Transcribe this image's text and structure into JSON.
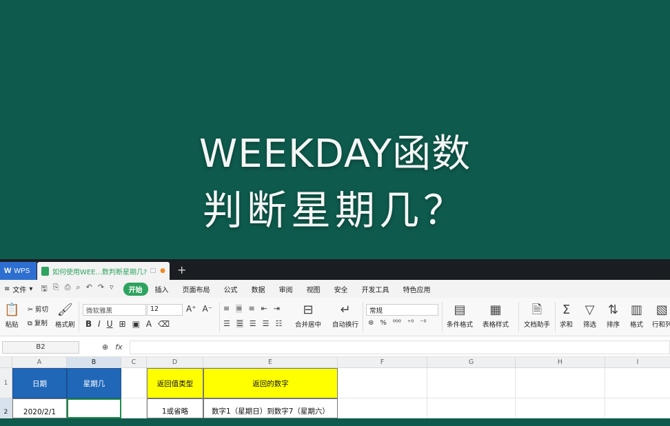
{
  "banner": {
    "line1": "WEEKDAY函数",
    "line2": "判断星期几？"
  },
  "tabbar": {
    "app_tab": "WPS",
    "doc_tab": "如何使用WEE...数判断星期几?",
    "new_tab": "+"
  },
  "menubar": {
    "file": "文件",
    "items": [
      "开始",
      "插入",
      "页面布局",
      "公式",
      "数据",
      "审阅",
      "视图",
      "安全",
      "开发工具",
      "特色应用"
    ]
  },
  "ribbon": {
    "paste": "粘贴",
    "cut": "剪切",
    "copy": "复制",
    "format_painter": "格式刷",
    "font_name": "微软雅黑",
    "font_size": "12",
    "merge_center": "合并居中",
    "wrap_text": "自动换行",
    "number_format": "常规",
    "conditional_format": "条件格式",
    "table_style": "表格样式",
    "doc_assistant": "文档助手",
    "sum": "求和",
    "filter": "筛选",
    "sort": "排序",
    "format": "格式",
    "row_col": "行和列"
  },
  "formula": {
    "name_box": "B2",
    "fx": "fx",
    "value": ""
  },
  "columns": [
    "A",
    "B",
    "C",
    "D",
    "E",
    "F",
    "G",
    "H",
    "I"
  ],
  "rows": [
    "1",
    "2"
  ],
  "cells": {
    "A1": "日期",
    "B1": "星期几",
    "D1": "返回值类型",
    "E1": "返回的数字",
    "A2": "2020/2/1",
    "B2": "",
    "D2": "1或省略",
    "E2": "数字1（星期日）到数字7（星期六）"
  },
  "colors": {
    "banner_bg": "#0e5b4d",
    "header_blue": "#2067b8",
    "header_yellow": "#ffff00",
    "accent_green": "#2ea35f"
  }
}
